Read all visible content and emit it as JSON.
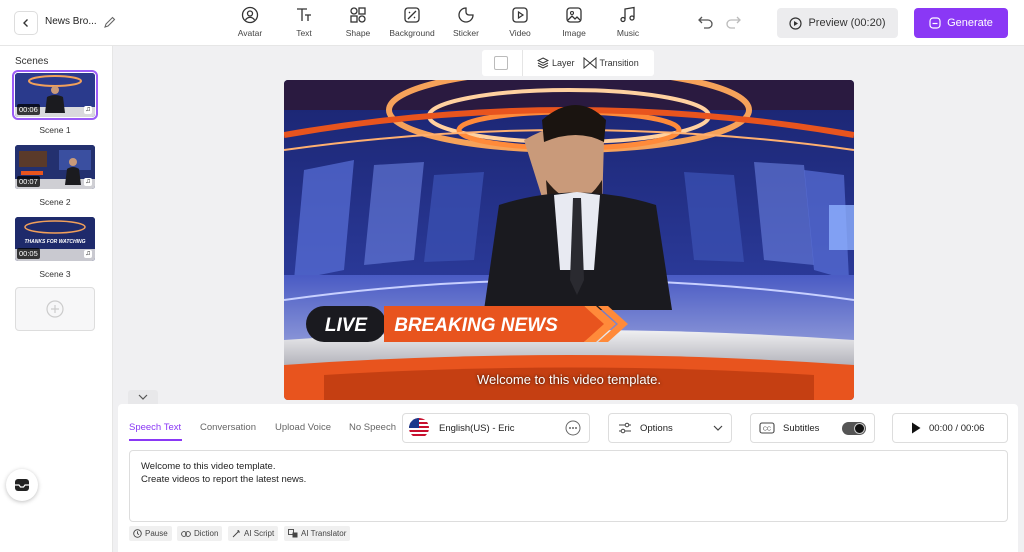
{
  "project": {
    "name": "News Bro..."
  },
  "toolbar": {
    "items": [
      {
        "label": "Avatar",
        "icon": "avatar-icon"
      },
      {
        "label": "Text",
        "icon": "text-icon"
      },
      {
        "label": "Shape",
        "icon": "shape-icon"
      },
      {
        "label": "Background",
        "icon": "background-icon"
      },
      {
        "label": "Sticker",
        "icon": "sticker-icon"
      },
      {
        "label": "Video",
        "icon": "video-icon"
      },
      {
        "label": "Image",
        "icon": "image-icon"
      },
      {
        "label": "Music",
        "icon": "music-icon"
      }
    ],
    "preview_label": "Preview (00:20)",
    "generate_label": "Generate"
  },
  "sidebar": {
    "title": "Scenes",
    "scenes": [
      {
        "name": "Scene 1",
        "duration": "00:06",
        "selected": true
      },
      {
        "name": "Scene 2",
        "duration": "00:07",
        "selected": false
      },
      {
        "name": "Scene 3",
        "duration": "00:05",
        "selected": false
      }
    ]
  },
  "canvas_toolbar": {
    "layer_label": "Layer",
    "transition_label": "Transition"
  },
  "stage": {
    "live_text": "LIVE",
    "breaking_text": "BREAKING NEWS",
    "caption": "Welcome to this video template.",
    "thumb3_text": "THANKS FOR WATCHING"
  },
  "panel": {
    "tabs": [
      "Speech Text",
      "Conversation",
      "Upload Voice",
      "No Speech"
    ],
    "active_tab": "Speech Text",
    "voice": "English(US) - Eric",
    "options_label": "Options",
    "subtitles_label": "Subtitles",
    "subtitles_on": true,
    "playback": "00:00 / 00:06",
    "speech_lines": [
      "Welcome to this video template.",
      "Create videos to report the latest news."
    ],
    "chips": [
      "Pause",
      "Diction",
      "AI Script",
      "AI Translator"
    ]
  },
  "colors": {
    "accent": "#8a38f5",
    "banner_orange": "#e8541e",
    "stage_blue": "#1e2a7a"
  }
}
